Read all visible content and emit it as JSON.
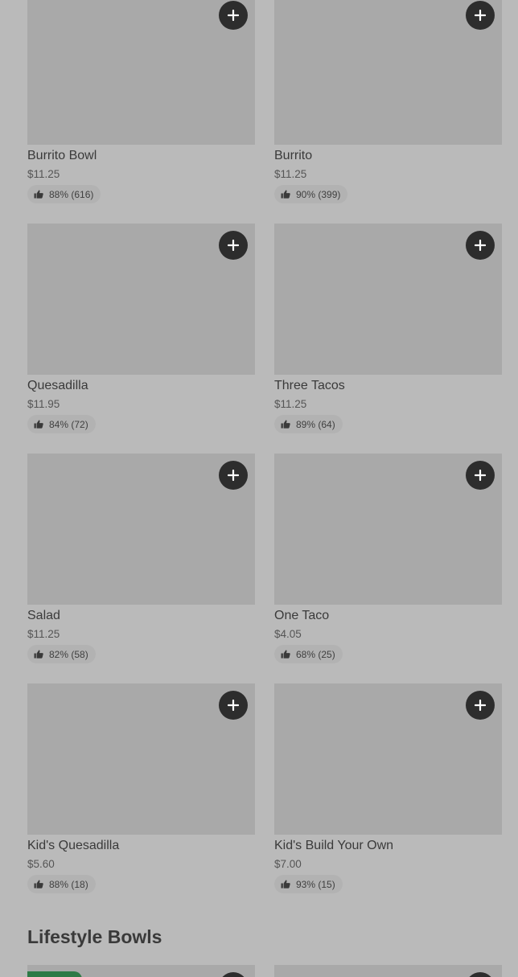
{
  "menu": {
    "items": [
      {
        "name": "Burrito Bowl",
        "price": "$11.25",
        "rating": "88% (616)"
      },
      {
        "name": "Burrito",
        "price": "$11.25",
        "rating": "90% (399)"
      },
      {
        "name": "Quesadilla",
        "price": "$11.95",
        "rating": "84% (72)"
      },
      {
        "name": "Three Tacos",
        "price": "$11.25",
        "rating": "89% (64)"
      },
      {
        "name": "Salad",
        "price": "$11.25",
        "rating": "82% (58)"
      },
      {
        "name": "One Taco",
        "price": "$4.05",
        "rating": "68% (25)"
      },
      {
        "name": "Kid's Quesadilla",
        "price": "$5.60",
        "rating": "88% (18)"
      },
      {
        "name": "Kid's Build Your Own",
        "price": "$7.00",
        "rating": "93% (15)"
      }
    ]
  },
  "sections": {
    "lifestyle_title": "Lifestyle Bowls"
  },
  "icons": {
    "add": "plus-icon",
    "rating": "thumbs-up-icon"
  },
  "colors": {
    "background": "#bababa",
    "image_placeholder": "#a9a9a9",
    "add_button": "#2d2d2d",
    "badge": "#2f7a47"
  }
}
